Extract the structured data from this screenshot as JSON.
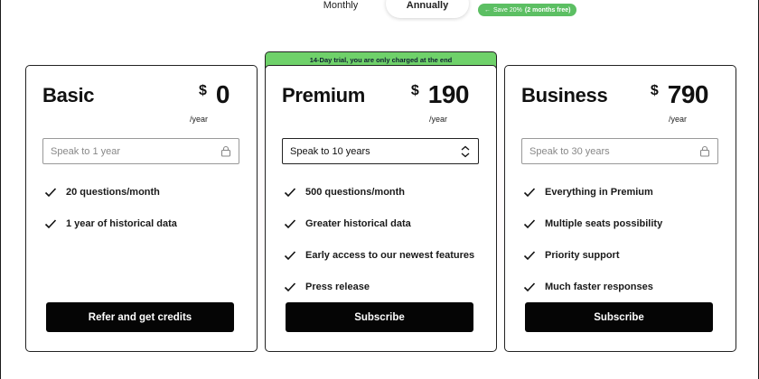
{
  "billing": {
    "monthly_label": "Monthly",
    "annual_label": "Annually",
    "save_prefix": "Save 20%",
    "save_suffix": "(2 months free)",
    "selected": "Annually"
  },
  "plans": [
    {
      "name": "Basic",
      "currency": "$",
      "price": "0",
      "period": "/year",
      "select_value": "Speak to 1 year",
      "select_locked": true,
      "features": [
        "20 questions/month",
        "1 year of historical data"
      ],
      "cta": "Refer and get credits"
    },
    {
      "name": "Premium",
      "banner": "14-Day trial, you are only charged at the end",
      "currency": "$",
      "price": "190",
      "period": "/year",
      "select_value": "Speak to 10 years",
      "select_locked": false,
      "features": [
        "500 questions/month",
        "Greater historical data",
        "Early access to our newest features",
        "Press release"
      ],
      "cta": "Subscribe"
    },
    {
      "name": "Business",
      "currency": "$",
      "price": "790",
      "period": "/year",
      "select_value": "Speak to 30 years",
      "select_locked": true,
      "features": [
        "Everything in Premium",
        "Multiple seats possibility",
        "Priority support",
        "Much faster responses"
      ],
      "cta": "Subscribe"
    }
  ],
  "colors": {
    "accent_green": "#6fd16a",
    "button_bg": "#050505",
    "border": "#222222"
  },
  "icons": {
    "feature": "check-icon",
    "locked": "lock-icon",
    "select": "chevron-up-down-icon",
    "badge": "arrow-left-icon"
  }
}
